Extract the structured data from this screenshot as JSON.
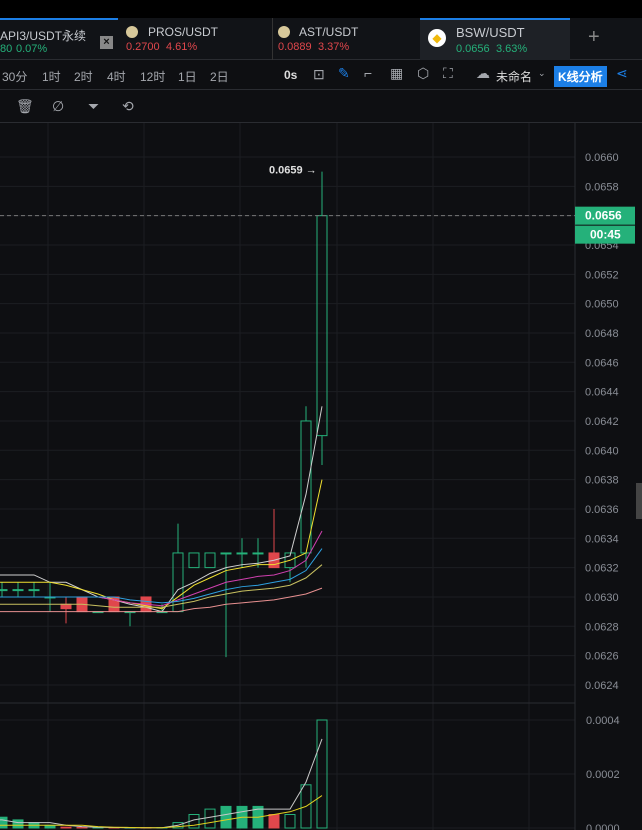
{
  "tabs": [
    {
      "name": "API3/USDT永续",
      "price": "80",
      "change": "0.07%",
      "dir": "up"
    },
    {
      "name": "PROS/USDT",
      "price": "0.2700",
      "change": "4.61%",
      "dir": "dn"
    },
    {
      "name": "AST/USDT",
      "price": "0.0889",
      "change": "3.37%",
      "dir": "dn"
    },
    {
      "name": "BSW/USDT",
      "price": "0.0656",
      "change": "3.63%",
      "dir": "up"
    }
  ],
  "intervals": [
    "30分",
    "1时",
    "2时",
    "4时",
    "12时",
    "1日",
    "2日"
  ],
  "toolbar": {
    "countdown": "0s",
    "layout_name": "未命名",
    "analysis": "K线分析"
  },
  "chart_data": {
    "type": "candlestick",
    "price_axis": {
      "ticks": [
        "0.0660",
        "0.0658",
        "0.0656",
        "0.0654",
        "0.0652",
        "0.0650",
        "0.0648",
        "0.0646",
        "0.0644",
        "0.0642",
        "0.0640",
        "0.0638",
        "0.0636",
        "0.0634",
        "0.0632",
        "0.0630",
        "0.0628",
        "0.0626",
        "0.0624"
      ],
      "range": [
        0.0623,
        0.0661
      ]
    },
    "last_price": "0.0656",
    "countdown": "00:45",
    "high_label": "0.0659",
    "candles": [
      [
        0.06305,
        0.0631,
        0.063,
        0.06305
      ],
      [
        0.06305,
        0.0631,
        0.063,
        0.06305
      ],
      [
        0.06305,
        0.0631,
        0.063,
        0.06305
      ],
      [
        0.06305,
        0.0631,
        0.063,
        0.06305
      ],
      [
        0.063,
        0.0631,
        0.0629,
        0.063
      ],
      [
        0.06295,
        0.063,
        0.06282,
        0.06292
      ],
      [
        0.063,
        0.063,
        0.0629,
        0.0629
      ],
      [
        0.0629,
        0.0629,
        0.0629,
        0.0629
      ],
      [
        0.063,
        0.063,
        0.0629,
        0.0629
      ],
      [
        0.0629,
        0.0629,
        0.0628,
        0.0629
      ],
      [
        0.063,
        0.063,
        0.0629,
        0.0629
      ],
      [
        0.0629,
        0.06295,
        0.0629,
        0.0629
      ],
      [
        0.0629,
        0.0635,
        0.0629,
        0.0633
      ],
      [
        0.0632,
        0.0633,
        0.0632,
        0.0633
      ],
      [
        0.0632,
        0.0633,
        0.0632,
        0.0633
      ],
      [
        0.0633,
        0.0633,
        0.06259,
        0.0633
      ],
      [
        0.0633,
        0.0634,
        0.0632,
        0.0633
      ],
      [
        0.0633,
        0.0634,
        0.0632,
        0.0633
      ],
      [
        0.0633,
        0.0636,
        0.0632,
        0.0632
      ],
      [
        0.0632,
        0.0633,
        0.0631,
        0.0633
      ],
      [
        0.0633,
        0.0643,
        0.0632,
        0.0642
      ],
      [
        0.0641,
        0.0659,
        0.0639,
        0.0656
      ]
    ],
    "ma": [
      {
        "color": "#d0d0d0",
        "values": [
          0.06315,
          0.06315,
          0.06315,
          0.06315,
          0.0631,
          0.0631,
          0.06305,
          0.063,
          0.06298,
          0.06295,
          0.06293,
          0.0629,
          0.06305,
          0.0631,
          0.06316,
          0.0632,
          0.06322,
          0.06323,
          0.06325,
          0.06328,
          0.0637,
          0.0643
        ]
      },
      {
        "color": "#f0e030",
        "values": [
          0.0631,
          0.0631,
          0.0631,
          0.0631,
          0.0631,
          0.06308,
          0.06305,
          0.06302,
          0.06298,
          0.06296,
          0.06294,
          0.06292,
          0.063,
          0.06308,
          0.06313,
          0.06318,
          0.0632,
          0.06322,
          0.06322,
          0.06325,
          0.0633,
          0.0638
        ]
      },
      {
        "color": "#d040b0",
        "values": [
          0.063,
          0.063,
          0.063,
          0.063,
          0.063,
          0.063,
          0.063,
          0.063,
          0.06298,
          0.06296,
          0.06295,
          0.06294,
          0.06298,
          0.06302,
          0.06306,
          0.0631,
          0.06312,
          0.06314,
          0.06315,
          0.06318,
          0.06325,
          0.06345
        ]
      },
      {
        "color": "#2ea0e0",
        "values": [
          0.063,
          0.063,
          0.063,
          0.063,
          0.063,
          0.063,
          0.063,
          0.063,
          0.063,
          0.06298,
          0.06297,
          0.06296,
          0.06297,
          0.06299,
          0.06302,
          0.06305,
          0.06307,
          0.06308,
          0.0631,
          0.06312,
          0.06318,
          0.06333
        ]
      },
      {
        "color": "#c8c060",
        "values": [
          0.06295,
          0.06295,
          0.06295,
          0.06295,
          0.06295,
          0.06295,
          0.06295,
          0.06294,
          0.06293,
          0.06293,
          0.06293,
          0.06293,
          0.06295,
          0.06297,
          0.063,
          0.06302,
          0.06304,
          0.06305,
          0.06306,
          0.06308,
          0.06313,
          0.06322
        ]
      },
      {
        "color": "#e89090",
        "values": [
          0.0629,
          0.0629,
          0.0629,
          0.0629,
          0.0629,
          0.0629,
          0.0629,
          0.0629,
          0.0629,
          0.0629,
          0.0629,
          0.0629,
          0.0629,
          0.06292,
          0.06293,
          0.06295,
          0.06296,
          0.06297,
          0.06298,
          0.063,
          0.06302,
          0.06306
        ]
      }
    ],
    "volume_axis": {
      "ticks": [
        "0.0004",
        "0.0002",
        "0.0000"
      ],
      "range": [
        0,
        0.00043
      ]
    },
    "volume": [
      5e-05,
      4e-05,
      3e-05,
      2e-05,
      1e-05,
      3e-06,
      2e-06,
      1e-06,
      2e-06,
      1e-06,
      1e-06,
      1e-06,
      2e-05,
      5e-05,
      7e-05,
      8e-05,
      8e-05,
      8e-05,
      5e-05,
      5e-05,
      0.00016,
      0.0004
    ],
    "volume_ma": [
      {
        "color": "#c8c8c8",
        "values": [
          3e-05,
          3e-05,
          2e-05,
          2e-05,
          2e-05,
          1e-05,
          5e-06,
          3e-06,
          2e-06,
          1e-06,
          1e-06,
          1e-06,
          1e-05,
          3e-05,
          4e-05,
          5e-05,
          6e-05,
          7e-05,
          7e-05,
          7e-05,
          0.00017,
          0.00033
        ]
      },
      {
        "color": "#e0d020",
        "values": [
          1e-05,
          1e-05,
          1e-05,
          1e-05,
          1e-05,
          1e-05,
          1e-05,
          5e-06,
          3e-06,
          2e-06,
          1e-06,
          1e-06,
          5e-06,
          1e-05,
          2e-05,
          3e-05,
          4e-05,
          4e-05,
          5e-05,
          6e-05,
          8e-05,
          0.00012
        ]
      }
    ]
  },
  "colors": {
    "up": "#25b17a",
    "down": "#e0474c",
    "accent": "#1c7fe6"
  }
}
